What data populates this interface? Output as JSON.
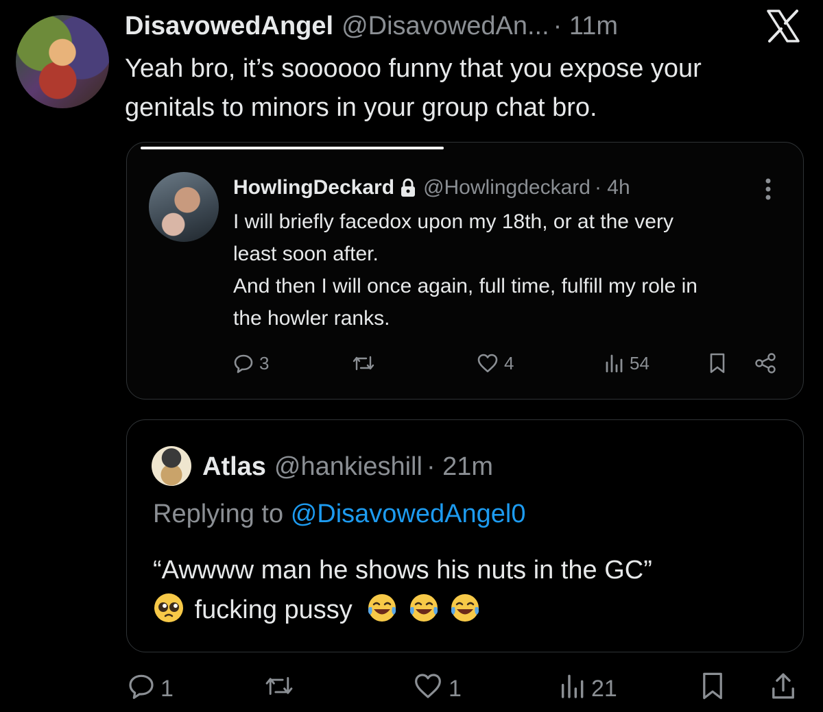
{
  "tweet": {
    "display_name": "DisavowedAngel",
    "handle": "@DisavowedAn...",
    "time": "· 11m",
    "text": "Yeah bro, it’s soooooo funny that you expose your genitals to minors in your group chat bro.",
    "logo_icon": "x-logo-icon"
  },
  "quoted": {
    "display_name": "HowlingDeckard",
    "handle": "@Howlingdeckard",
    "time": "· 4h",
    "text_lines": [
      "I will briefly facedox upon my 18th, or at the very",
      "least soon after.",
      "And then I will once again, full time, fulfill my role in",
      "the howler ranks."
    ],
    "video_progress": 0.47,
    "actions": {
      "replies": "3",
      "retweets": "",
      "likes": "4",
      "views": "54"
    }
  },
  "reply": {
    "display_name": "Atlas",
    "handle": "@hankieshill",
    "time": "· 21m",
    "replying_prefix": "Replying to",
    "replying_to": "@DisavowedAngel0",
    "line1": "“Awwww man he shows his nuts in the GC”",
    "line2": "fucking pussy",
    "emojis": [
      "pleading-face-emoji",
      "tears-of-joy-emoji",
      "tears-of-joy-emoji",
      "tears-of-joy-emoji"
    ]
  },
  "actions": {
    "replies": "1",
    "retweets": "",
    "likes": "1",
    "views": "21"
  },
  "colors": {
    "background": "#000000",
    "text": "#e7e9ea",
    "muted": "#8b8f94",
    "link": "#1d9bf0",
    "border": "#2f3336"
  }
}
